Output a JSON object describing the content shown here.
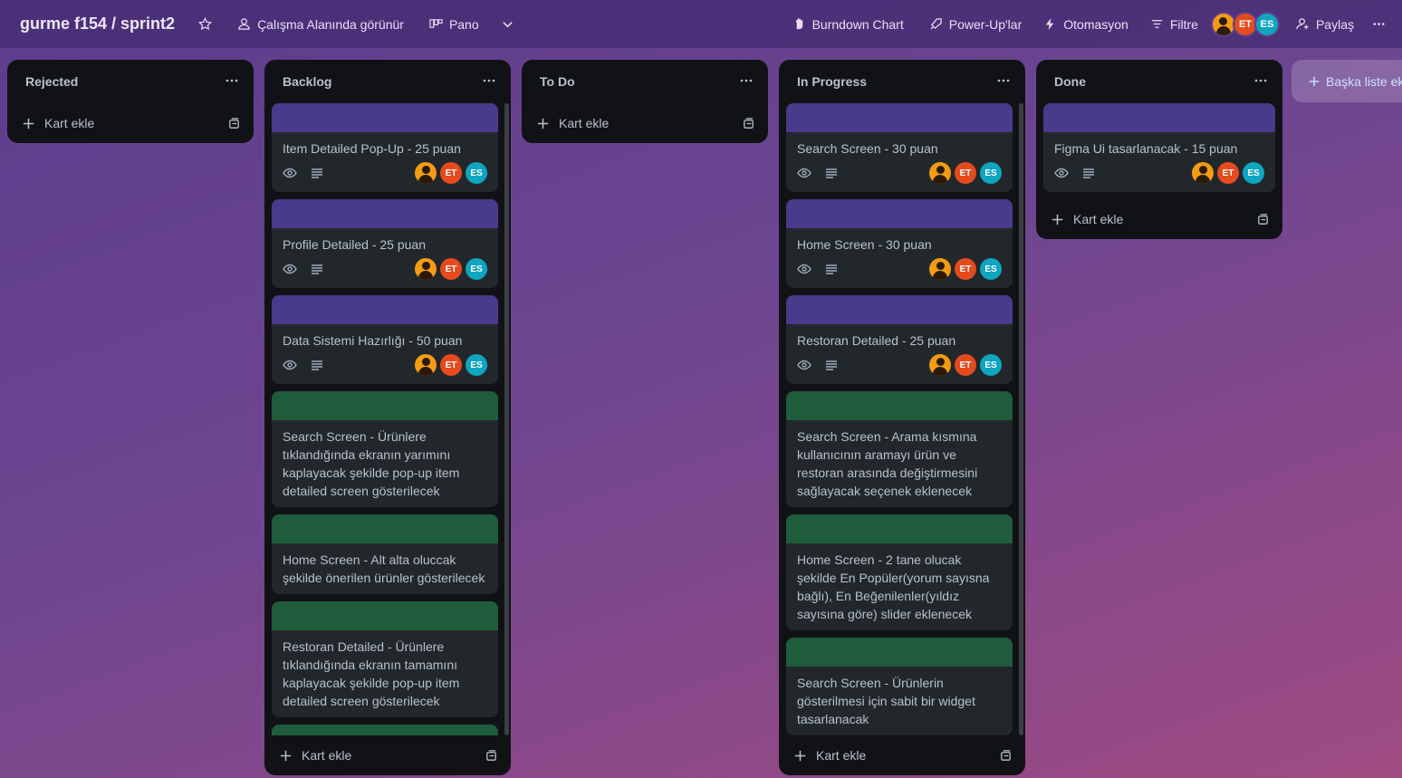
{
  "header": {
    "board_title": "gurme f154 / sprint2",
    "visibility_label": "Çalışma Alanında görünür",
    "view_label": "Pano",
    "burndown_label": "Burndown Chart",
    "powerups_label": "Power-Up'lar",
    "automation_label": "Otomasyon",
    "filter_label": "Filtre",
    "share_label": "Paylaş",
    "member_initials": [
      "ET",
      "ES"
    ]
  },
  "add_card_label": "Kart ekle",
  "add_list_label": "Başka liste ekle",
  "colors": {
    "cover_purple": "#4a3a8c",
    "cover_green": "#1f5c3c"
  },
  "lists": [
    {
      "title": "Rejected",
      "cards": []
    },
    {
      "title": "Backlog",
      "cards": [
        {
          "cover": "purple",
          "title": "Item Detailed Pop-Up - 25 puan",
          "badges": true
        },
        {
          "cover": "purple",
          "title": "Profile Detailed - 25 puan",
          "badges": true
        },
        {
          "cover": "purple",
          "title": "Data Sistemi Hazırlığı - 50 puan",
          "badges": true
        },
        {
          "cover": "green",
          "title": "Search Screen - Ürünlere tıklandığında ekranın yarımını kaplayacak şekilde pop-up item detailed screen gösterilecek",
          "badges": false
        },
        {
          "cover": "green",
          "title": "Home Screen - Alt alta oluccak şekilde önerilen ürünler gösterilecek",
          "badges": false
        },
        {
          "cover": "green",
          "title": "Restoran Detailed - Ürünlere tıklandığında ekranın tamamını kaplayacak şekilde pop-up item detailed screen gösterilecek",
          "badges": false
        },
        {
          "cover": "green",
          "title": "",
          "badges": false
        }
      ]
    },
    {
      "title": "To Do",
      "cards": []
    },
    {
      "title": "In Progress",
      "cards": [
        {
          "cover": "purple",
          "title": "Search Screen - 30 puan",
          "badges": true
        },
        {
          "cover": "purple",
          "title": "Home Screen - 30 puan",
          "badges": true
        },
        {
          "cover": "purple",
          "title": "Restoran Detailed - 25 puan",
          "badges": true
        },
        {
          "cover": "green",
          "title": "Search Screen - Arama kısmına kullanıcının aramayı ürün ve restoran arasında değiştirmesini sağlayacak seçenek eklenecek",
          "badges": false
        },
        {
          "cover": "green",
          "title": "Home Screen - 2 tane olucak şekilde En Popüler(yorum sayısna bağlı), En Beğenilenler(yıldız sayısına göre) slider eklenecek",
          "badges": false
        },
        {
          "cover": "green",
          "title": "Search Screen - Ürünlerin gösterilmesi için sabit bir widget tasarlanacak",
          "badges": false
        }
      ]
    },
    {
      "title": "Done",
      "cards": [
        {
          "cover": "purple",
          "title": "Figma Ui tasarlanacak - 15 puan",
          "badges": true
        }
      ]
    }
  ]
}
